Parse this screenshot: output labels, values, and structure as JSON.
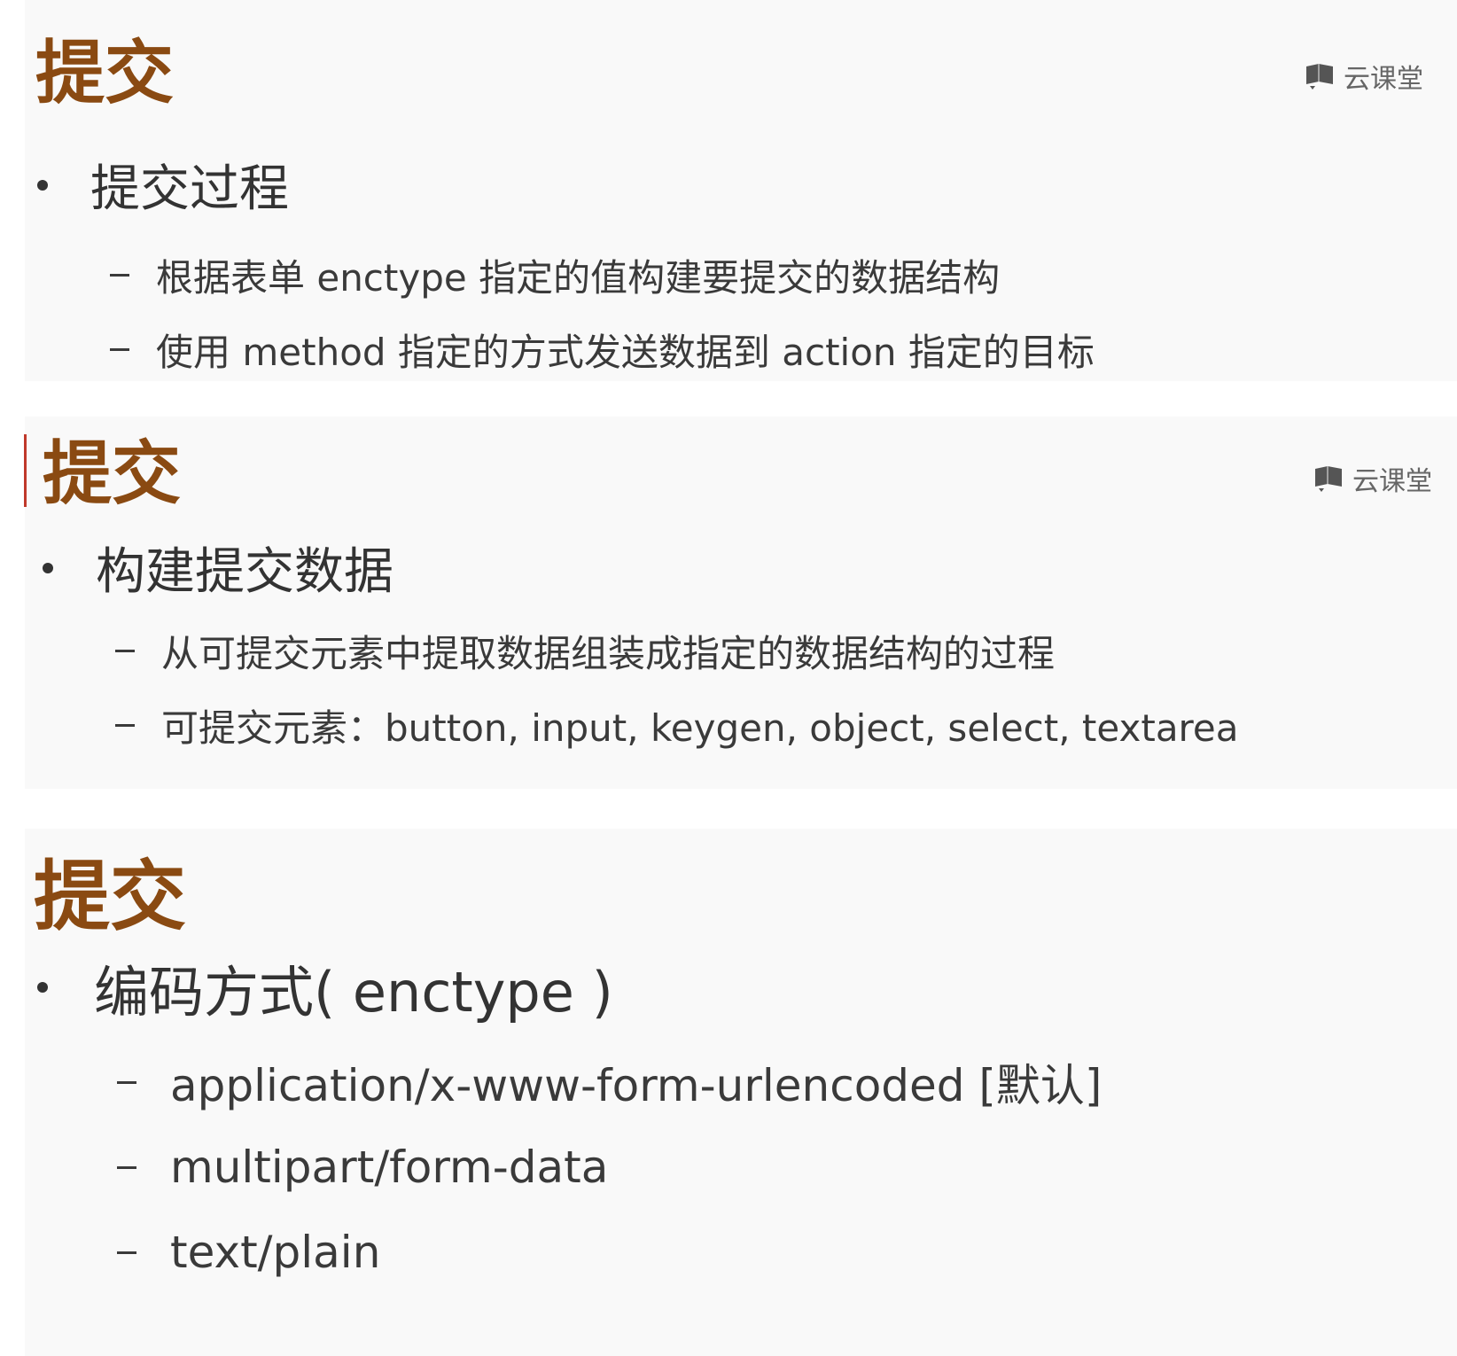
{
  "logo": {
    "text": "云课堂",
    "icon": "book-icon"
  },
  "slides": [
    {
      "title": "提交",
      "bullet": "提交过程",
      "items": [
        "根据表单 enctype 指定的值构建要提交的数据结构",
        "使用 method 指定的方式发送数据到 action 指定的目标"
      ]
    },
    {
      "title": "提交",
      "bullet": "构建提交数据",
      "items": [
        "从可提交元素中提取数据组装成指定的数据结构的过程",
        "可提交元素：button, input, keygen, object, select, textarea"
      ]
    },
    {
      "title": "提交",
      "bullet": "编码方式( enctype )",
      "items": [
        "application/x-www-form-urlencoded [默认]",
        "multipart/form-data",
        "text/plain"
      ]
    }
  ],
  "colors": {
    "title": "#8a4a12",
    "accent": "#c0392b",
    "text": "#333333"
  }
}
